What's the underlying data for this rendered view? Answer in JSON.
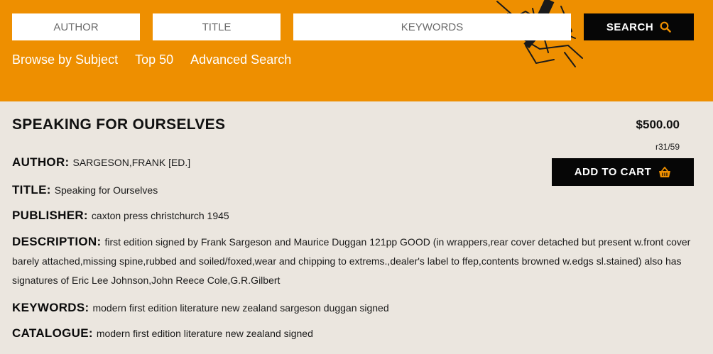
{
  "search": {
    "author_placeholder": "AUTHOR",
    "title_placeholder": "TITLE",
    "keywords_placeholder": "KEYWORDS",
    "button_label": "SEARCH",
    "button_icon": "search-icon"
  },
  "nav": {
    "items": [
      "Browse by Subject",
      "Top 50",
      "Advanced Search"
    ]
  },
  "book": {
    "title": "SPEAKING FOR OURSELVES",
    "price": "$500.00",
    "ref": "r31/59",
    "add_to_cart_label": "ADD TO CART",
    "cart_icon": "basket-icon",
    "fields": {
      "author": {
        "label": "AUTHOR:",
        "value": "SARGESON,FRANK [ED.]"
      },
      "title": {
        "label": "TITLE:",
        "value": "Speaking for Ourselves"
      },
      "publisher": {
        "label": "PUBLISHER:",
        "value": "caxton press christchurch 1945"
      },
      "description": {
        "label": "DESCRIPTION:",
        "value": "first edition signed by Frank Sargeson and Maurice Duggan 121pp GOOD (in wrappers,rear cover detached but present w.front cover barely attached,missing spine,rubbed and soiled/foxed,wear and chipping to extrems.,dealer's label to ffep,contents browned w.edgs sl.stained) also has signatures of Eric Lee Johnson,John Reece Cole,G.R.Gilbert"
      },
      "keywords": {
        "label": "KEYWORDS:",
        "value": "modern first edition literature new zealand sargeson duggan signed"
      },
      "catalogue": {
        "label": "CATALOGUE:",
        "value": "modern first edition literature new zealand signed"
      }
    }
  },
  "colors": {
    "header_bg": "#ee8f00",
    "page_bg": "#ebe6df",
    "button_bg": "#060606",
    "icon_accent": "#ee8f00"
  }
}
